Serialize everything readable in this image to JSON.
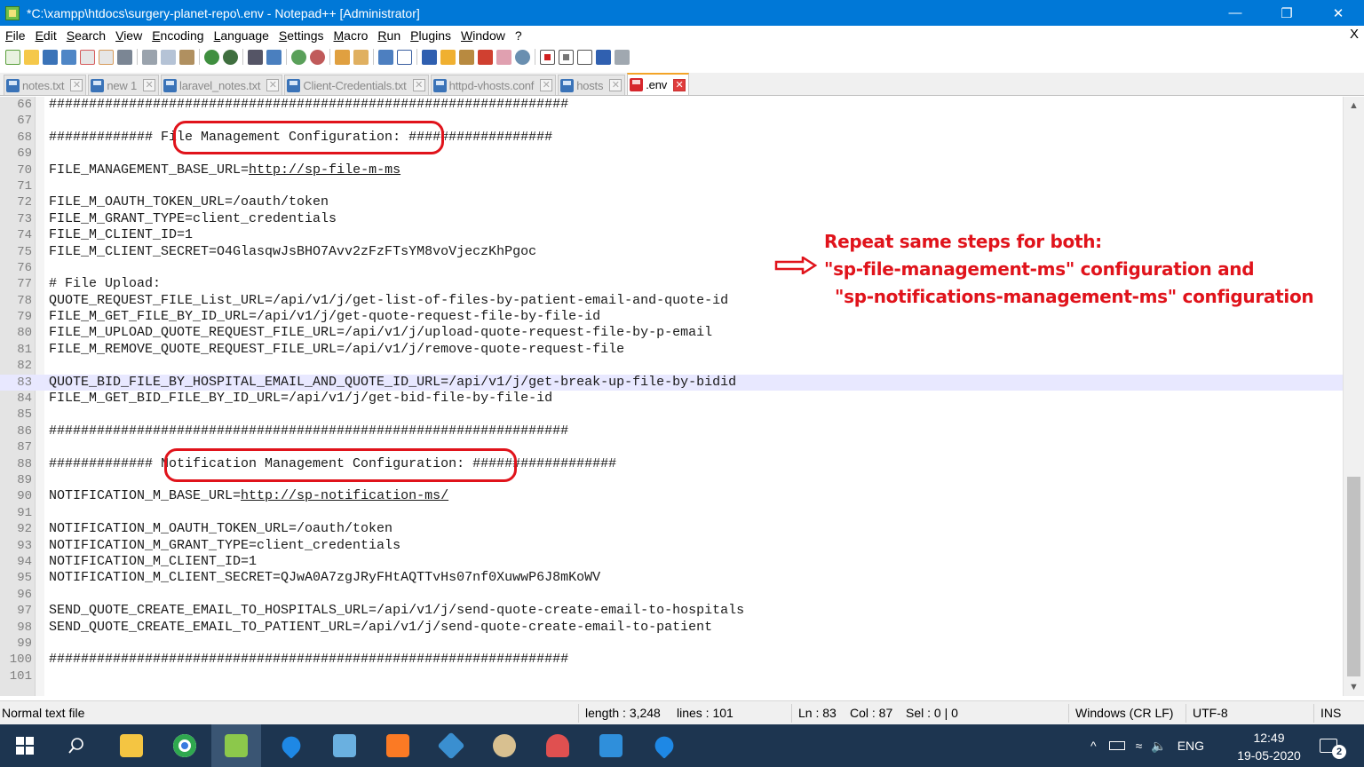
{
  "window": {
    "title": "*C:\\xampp\\htdocs\\surgery-planet-repo\\.env - Notepad++ [Administrator]",
    "minimize": "—",
    "maximize": "❐",
    "close": "✕"
  },
  "menu": [
    "File",
    "Edit",
    "Search",
    "View",
    "Encoding",
    "Language",
    "Settings",
    "Macro",
    "Run",
    "Plugins",
    "Window",
    "?"
  ],
  "menu_close": "X",
  "tabs": [
    {
      "label": "notes.txt",
      "close": "✕"
    },
    {
      "label": "new 1",
      "close": "✕"
    },
    {
      "label": "laravel_notes.txt",
      "close": "✕"
    },
    {
      "label": "Client-Credentials.txt",
      "close": "✕"
    },
    {
      "label": "httpd-vhosts.conf",
      "close": "✕"
    },
    {
      "label": "hosts",
      "close": "✕"
    },
    {
      "label": ".env",
      "close": "✕"
    }
  ],
  "editor": {
    "lines": [
      {
        "n": "66",
        "t": "#################################################################"
      },
      {
        "n": "67",
        "t": ""
      },
      {
        "n": "68",
        "t": "############# File Management Configuration: ##################"
      },
      {
        "n": "69",
        "t": ""
      },
      {
        "n": "70",
        "t": "FILE_MANAGEMENT_BASE_URL=",
        "link": "http://sp-file-m-ms"
      },
      {
        "n": "71",
        "t": ""
      },
      {
        "n": "72",
        "t": "FILE_M_OAUTH_TOKEN_URL=/oauth/token"
      },
      {
        "n": "73",
        "t": "FILE_M_GRANT_TYPE=client_credentials"
      },
      {
        "n": "74",
        "t": "FILE_M_CLIENT_ID=1"
      },
      {
        "n": "75",
        "t": "FILE_M_CLIENT_SECRET=O4GlasqwJsBHO7Avv2zFzFTsYM8voVjeczKhPgoc"
      },
      {
        "n": "76",
        "t": ""
      },
      {
        "n": "77",
        "t": "# File Upload:"
      },
      {
        "n": "78",
        "t": "QUOTE_REQUEST_FILE_List_URL=/api/v1/j/get-list-of-files-by-patient-email-and-quote-id"
      },
      {
        "n": "79",
        "t": "FILE_M_GET_FILE_BY_ID_URL=/api/v1/j/get-quote-request-file-by-file-id"
      },
      {
        "n": "80",
        "t": "FILE_M_UPLOAD_QUOTE_REQUEST_FILE_URL=/api/v1/j/upload-quote-request-file-by-p-email"
      },
      {
        "n": "81",
        "t": "FILE_M_REMOVE_QUOTE_REQUEST_FILE_URL=/api/v1/j/remove-quote-request-file"
      },
      {
        "n": "82",
        "t": ""
      },
      {
        "n": "83",
        "t": "QUOTE_BID_FILE_BY_HOSPITAL_EMAIL_AND_QUOTE_ID_URL=/api/v1/j/get-break-up-file-by-bidid",
        "current": true
      },
      {
        "n": "84",
        "t": "FILE_M_GET_BID_FILE_BY_ID_URL=/api/v1/j/get-bid-file-by-file-id"
      },
      {
        "n": "85",
        "t": ""
      },
      {
        "n": "86",
        "t": "#################################################################"
      },
      {
        "n": "87",
        "t": ""
      },
      {
        "n": "88",
        "t": "############# Notification Management Configuration: ##################"
      },
      {
        "n": "89",
        "t": ""
      },
      {
        "n": "90",
        "t": "NOTIFICATION_M_BASE_URL=",
        "link": "http://sp-notification-ms/"
      },
      {
        "n": "91",
        "t": ""
      },
      {
        "n": "92",
        "t": "NOTIFICATION_M_OAUTH_TOKEN_URL=/oauth/token"
      },
      {
        "n": "93",
        "t": "NOTIFICATION_M_GRANT_TYPE=client_credentials"
      },
      {
        "n": "94",
        "t": "NOTIFICATION_M_CLIENT_ID=1"
      },
      {
        "n": "95",
        "t": "NOTIFICATION_M_CLIENT_SECRET=QJwA0A7zgJRyFHtAQTTvHs07nf0XuwwP6J8mKoWV"
      },
      {
        "n": "96",
        "t": ""
      },
      {
        "n": "97",
        "t": "SEND_QUOTE_CREATE_EMAIL_TO_HOSPITALS_URL=/api/v1/j/send-quote-create-email-to-hospitals"
      },
      {
        "n": "98",
        "t": "SEND_QUOTE_CREATE_EMAIL_TO_PATIENT_URL=/api/v1/j/send-quote-create-email-to-patient"
      },
      {
        "n": "99",
        "t": ""
      },
      {
        "n": "100",
        "t": "#################################################################"
      },
      {
        "n": "101",
        "t": ""
      }
    ]
  },
  "annotation": {
    "line1": "Repeat same steps for both:",
    "line2": "\"sp-file-management-ms\" configuration and",
    "line3": "\"sp-notifications-management-ms\" configuration",
    "color": "#e0131b"
  },
  "status": {
    "file_type": "Normal text file",
    "length": "length : 3,248",
    "lines": "lines : 101",
    "ln": "Ln : 83",
    "col": "Col : 87",
    "sel": "Sel : 0 | 0",
    "eol": "Windows (CR LF)",
    "encoding": "UTF-8",
    "mode": "INS"
  },
  "taskbar": {
    "lang": "ENG",
    "time": "12:49",
    "date": "19-05-2020",
    "notifications": "2"
  }
}
